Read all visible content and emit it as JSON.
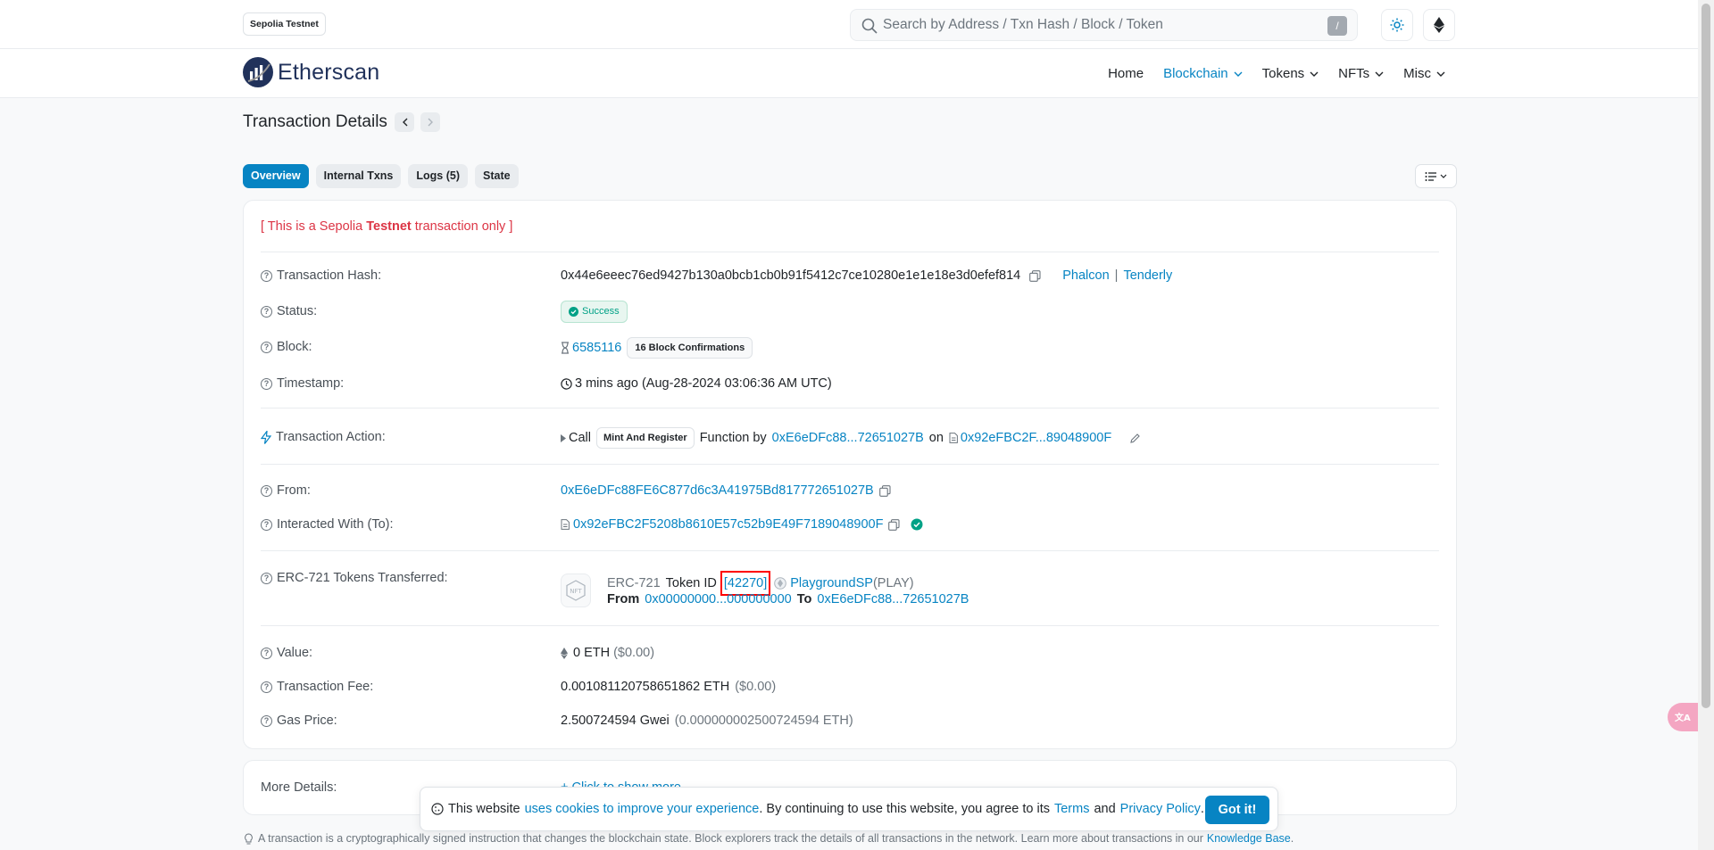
{
  "topbar": {
    "network_badge": "Sepolia Testnet",
    "search_placeholder": "Search by Address / Txn Hash / Block / Token",
    "search_shortcut": "/"
  },
  "navbar": {
    "logo_text": "Etherscan",
    "items": [
      "Home",
      "Blockchain",
      "Tokens",
      "NFTs",
      "Misc"
    ],
    "active_item": "Blockchain"
  },
  "page": {
    "title": "Transaction Details"
  },
  "tabs": [
    "Overview",
    "Internal Txns",
    "Logs (5)",
    "State"
  ],
  "notice": {
    "prefix": "[ This is a Sepolia ",
    "bold": "Testnet",
    "suffix": " transaction only ]"
  },
  "details": {
    "tx_hash_label": "Transaction Hash:",
    "tx_hash": "0x44e6eeec76ed9427b130a0bcb1cb0b91f5412c7ce10280e1e1e18e3d0efef814",
    "phalcon": "Phalcon",
    "sep": "|",
    "tenderly": "Tenderly",
    "status_label": "Status:",
    "status": "Success",
    "block_label": "Block:",
    "block": "6585116",
    "confirmations": "16 Block Confirmations",
    "timestamp_label": "Timestamp:",
    "timestamp": "3 mins ago (Aug-28-2024 03:06:36 AM UTC)",
    "action_label": "Transaction Action:",
    "action_call": "Call",
    "action_method": "Mint And Register",
    "action_function_by": "Function by",
    "action_from": "0xE6eDFc88...72651027B",
    "action_on": "on",
    "action_contract": "0x92eFBC2F...89048900F",
    "from_label": "From:",
    "from": "0xE6eDFc88FE6C877d6c3A41975Bd817772651027B",
    "to_label": "Interacted With (To):",
    "to": "0x92eFBC2F5208b8610E57c52b9E49F7189048900F",
    "erc721_label": "ERC-721 Tokens Transferred:",
    "erc721_type": "ERC-721",
    "token_id_label": "Token ID",
    "token_id": "[42270]",
    "token_name": "PlaygroundSP",
    "token_symbol": "(PLAY)",
    "transfer_from_label": "From",
    "transfer_from": "0x00000000...000000000",
    "transfer_to_label": "To",
    "transfer_to": "0xE6eDFc88...72651027B",
    "value_label": "Value:",
    "value": "0 ETH",
    "value_usd": "($0.00)",
    "fee_label": "Transaction Fee:",
    "fee": "0.001081120758651862 ETH",
    "fee_usd": "($0.00)",
    "gas_label": "Gas Price:",
    "gas": "2.500724594 Gwei",
    "gas_eth": "(0.000000002500724594 ETH)"
  },
  "more": {
    "label": "More Details:",
    "link": "+ Click to show more"
  },
  "cookie": {
    "t1": "This website",
    "link1": "uses cookies to improve your experience",
    "t2": ". By continuing to use this website, you agree to its",
    "terms": "Terms",
    "and": "and",
    "privacy": "Privacy Policy",
    "dot": ".",
    "button": "Got it!"
  },
  "footer": {
    "text": "A transaction is a cryptographically signed instruction that changes the blockchain state. Block explorers track the details of all transactions in the network. Learn more about transactions in our",
    "link": "Knowledge Base",
    "dot": "."
  },
  "colors": {
    "accent": "#0784c3",
    "danger": "#dc3545",
    "success": "#00a186"
  }
}
